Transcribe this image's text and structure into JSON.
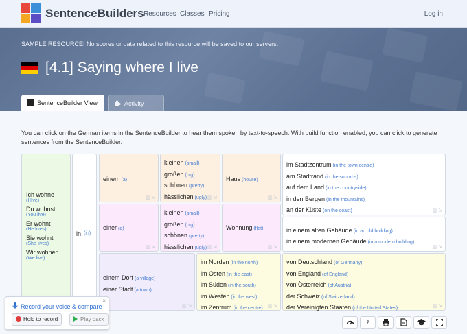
{
  "nav": {
    "brand": "SentenceBuilders",
    "links": [
      "Resources",
      "Classes",
      "Pricing"
    ],
    "login": "Log in",
    "logo_colors": [
      "#e8483b",
      "#3a8fd8",
      "#f5a623",
      "#5b4ec4"
    ]
  },
  "banner": {
    "notice": "SAMPLE RESOURCE! No scores or data related to this resource will be saved to our servers.",
    "title": "[4.1] Saying where I live",
    "flag_colors": [
      "#000000",
      "#dd0000",
      "#ffce00"
    ],
    "tabs": [
      {
        "label": "SentenceBuilder View",
        "icon": "grid-icon"
      },
      {
        "label": "Activity View",
        "icon": "puzzle-icon"
      }
    ]
  },
  "intro": "You can click on the German items in the SentenceBuilder to hear them spoken by text-to-speech. With build function enabled, you can click to generate sentences from the SentenceBuilder.",
  "builder": {
    "subjects": [
      {
        "de": "Ich wohne",
        "en": "(I live)"
      },
      {
        "de": "Du wohnst",
        "en": "(You live)"
      },
      {
        "de": "Er wohnt",
        "en": "(He lives)"
      },
      {
        "de": "Sie wohnt",
        "en": "(She lives)"
      },
      {
        "de": "Wir wohnen",
        "en": "(We live)"
      }
    ],
    "prep": {
      "de": "in",
      "en": "(in)"
    },
    "article_1": {
      "de": "einem",
      "en": "(a)"
    },
    "article_2": {
      "de": "einer",
      "en": "(a)"
    },
    "adjectives_1": [
      {
        "de": "kleinen",
        "en": "(small)"
      },
      {
        "de": "großen",
        "en": "(big)"
      },
      {
        "de": "schönen",
        "en": "(pretty)"
      },
      {
        "de": "hässlichen",
        "en": "(ugly)"
      }
    ],
    "adjectives_2": [
      {
        "de": "kleinen",
        "en": "(small)"
      },
      {
        "de": "großen",
        "en": "(big)"
      },
      {
        "de": "schönen",
        "en": "(pretty)"
      },
      {
        "de": "hässlichen",
        "en": "(ugly)"
      }
    ],
    "noun_1": {
      "de": "Haus",
      "en": "(house)"
    },
    "noun_2": {
      "de": "Wohnung",
      "en": "(flat)"
    },
    "places_1": [
      {
        "de": "im Stadtzentrum",
        "en": "(in the town centre)"
      },
      {
        "de": "am Stadtrand",
        "en": "(in the suburbs)"
      },
      {
        "de": "auf dem Land",
        "en": "(in the countryside)"
      },
      {
        "de": "in den Bergen",
        "en": "(in the mountains)"
      },
      {
        "de": "an der Küste",
        "en": "(on the coast)"
      }
    ],
    "places_2": [
      {
        "de": "in einem alten Gebäude",
        "en": "(in an old building)"
      },
      {
        "de": "in einem modernen Gebäude",
        "en": "(in a modern building)"
      }
    ],
    "village_town": [
      {
        "de": "einem Dorf",
        "en": "(a village)"
      },
      {
        "de": "einer Stadt",
        "en": "(a town)"
      }
    ],
    "directions": [
      {
        "de": "im Norden",
        "en": "(in the north)"
      },
      {
        "de": "im Osten",
        "en": "(in the east)"
      },
      {
        "de": "im Süden",
        "en": "(in the south)"
      },
      {
        "de": "im Westen",
        "en": "(in the west)"
      },
      {
        "de": "im Zentrum",
        "en": "(in the centre)"
      }
    ],
    "countries": [
      {
        "de": "von Deutschland",
        "en": "(of Germany)"
      },
      {
        "de": "von England",
        "en": "(of England)"
      },
      {
        "de": "von Österreich",
        "en": "(of Austria)"
      },
      {
        "de": "der Schweiz",
        "en": "(of Switzerland)"
      },
      {
        "de": "der Vereinigten Staaten",
        "en": "(of the United States)"
      }
    ]
  },
  "voice": {
    "title": "Record your voice & compare",
    "close": "×",
    "record": "Hold to record",
    "playback": "Play back"
  },
  "toolbar": {
    "icons": [
      "gauge-icon",
      "music-icon",
      "print-icon",
      "document-icon",
      "graduation-cap-icon",
      "fullscreen-icon"
    ]
  }
}
